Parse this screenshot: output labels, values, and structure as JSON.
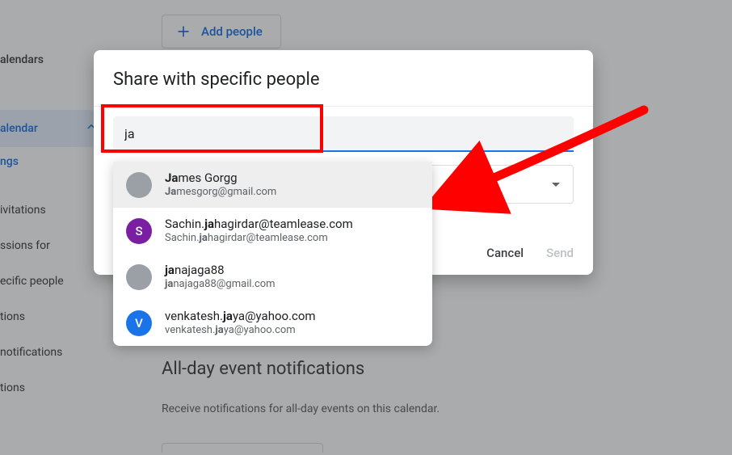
{
  "sidebar": {
    "heading": "alendars",
    "selected_label": "alendar",
    "sub_label": "ngs",
    "items": [
      "ivitations",
      "ssions for",
      "ecific people",
      "tions",
      "notifications",
      "tions"
    ]
  },
  "add_people_label": "Add people",
  "section_title": "All-day event notifications",
  "section_sub": "Receive notifications for all-day events on this calendar.",
  "dialog": {
    "title": "Share with specific people",
    "search_value": "ja",
    "cancel": "Cancel",
    "send": "Send"
  },
  "suggestions": [
    {
      "name_html": "<b>Ja</b>mes Gorgg",
      "email_html": "<b>Ja</b>mesgorg@gmail.com",
      "avatar_type": "photo",
      "avatar_class": "av-james",
      "hovered": true
    },
    {
      "name_html": "Sachin.<b>ja</b>hagirdar@teamlease.com",
      "email_html": "Sachin.<b>ja</b>hagirdar@teamlease.com",
      "avatar_type": "letter",
      "avatar_letter": "S",
      "avatar_bg": "#7b1fa2"
    },
    {
      "name_html": "<b>ja</b>najaga88",
      "email_html": "<b>ja</b>najaga88@gmail.com",
      "avatar_type": "photo",
      "avatar_class": "av-jana"
    },
    {
      "name_html": "venkatesh.<b>ja</b>ya@yahoo.com",
      "email_html": "venkatesh.<b>ja</b>ya@yahoo.com",
      "avatar_type": "letter",
      "avatar_letter": "V",
      "avatar_bg": "#1a73e8"
    }
  ]
}
